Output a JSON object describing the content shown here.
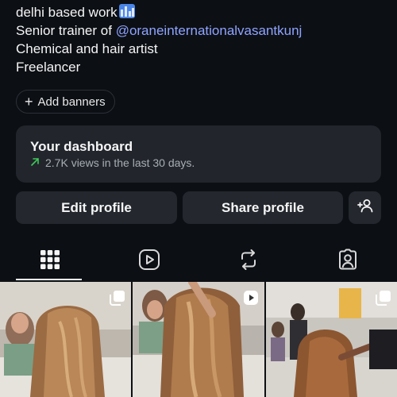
{
  "bio": {
    "line1": "delhi based work",
    "line2_prefix": "Senior trainer of ",
    "line2_mention": "@oraneinternationalvasantkunj",
    "line3": "Chemical and hair artist",
    "line4": "Freelancer",
    "emoji_icon": "cityscape-emoji"
  },
  "banners": {
    "label": "Add banners",
    "icon": "plus-icon"
  },
  "dashboard": {
    "title": "Your dashboard",
    "subtitle": "2.7K views in the last 30 days.",
    "trend_icon": "trend-up-arrow-icon",
    "trend_color": "#3ec95b"
  },
  "actions": {
    "edit": "Edit profile",
    "share": "Share profile",
    "add_person_icon": "add-person-icon"
  },
  "tabs": [
    {
      "name": "grid",
      "icon": "grid-icon",
      "active": true
    },
    {
      "name": "reels",
      "icon": "reels-icon",
      "active": false
    },
    {
      "name": "reposts",
      "icon": "repost-icon",
      "active": false
    },
    {
      "name": "tagged",
      "icon": "tagged-person-icon",
      "active": false
    }
  ],
  "posts": [
    {
      "badge": "multi-post-icon",
      "subject": "long wavy brown balayage hair, back view, salon"
    },
    {
      "badge": "reel-icon",
      "subject": "stylist tousling wavy caramel hair, salon"
    },
    {
      "badge": "multi-post-icon",
      "subject": "long hair with stylist hand, hair academy"
    }
  ],
  "colors": {
    "background": "#0c0f14",
    "card": "#22262c",
    "button": "#24282e",
    "mention": "#8fa4ff"
  }
}
